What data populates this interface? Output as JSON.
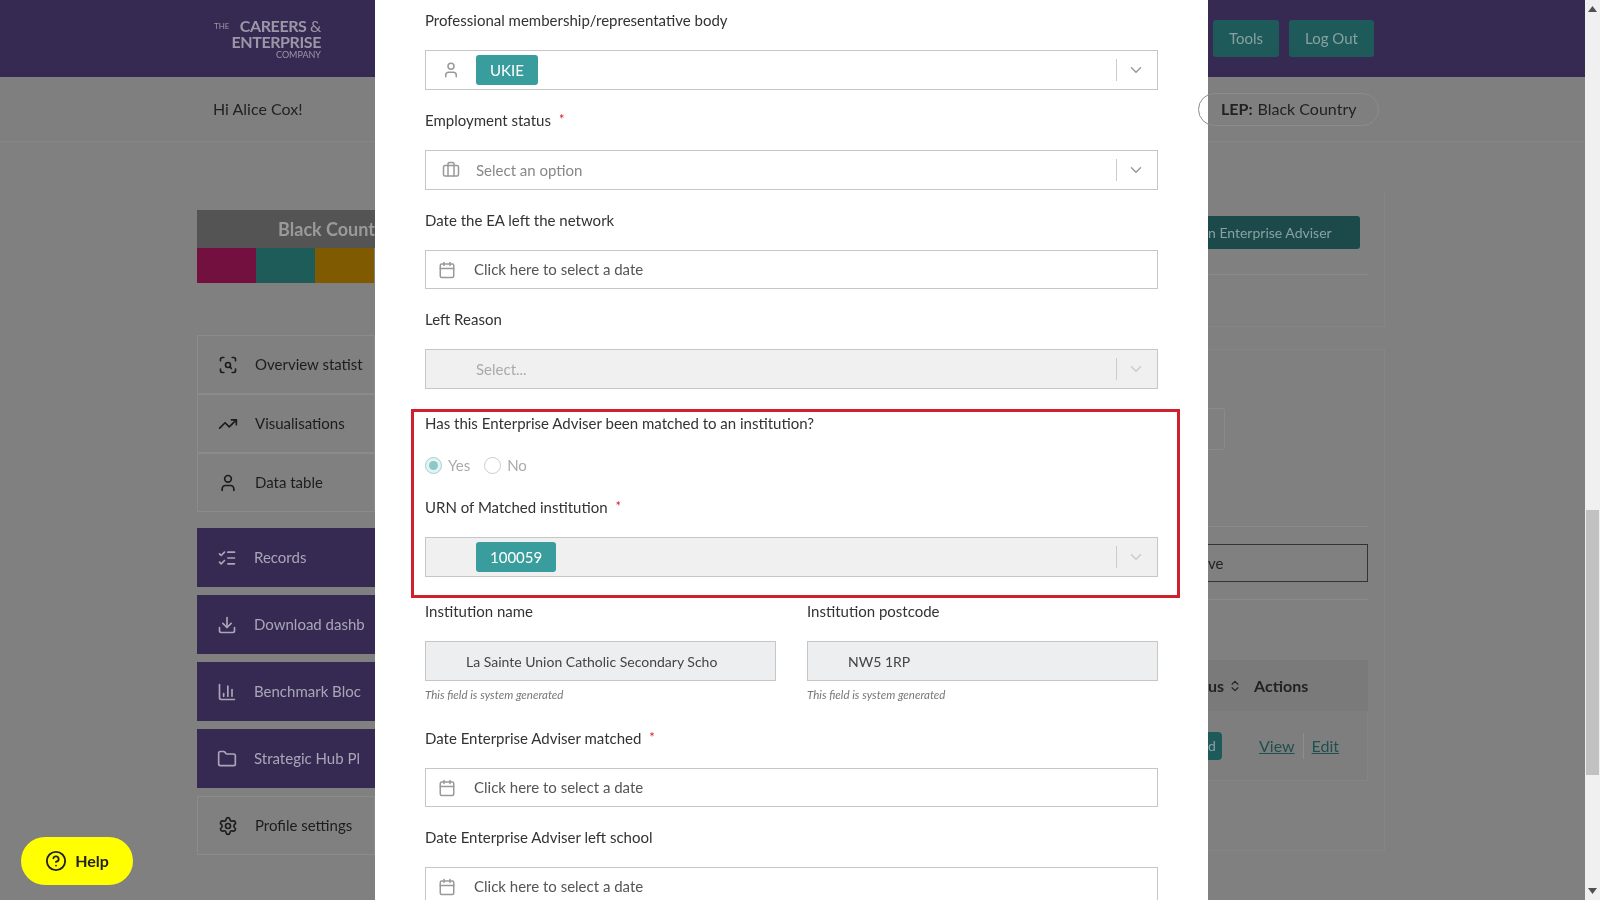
{
  "header": {
    "logo": {
      "the": "THE",
      "line1": "CAREERS",
      "amp": "&",
      "line2": "ENTERPRISE",
      "line3": "COMPANY"
    },
    "buttons": [
      "Tools",
      "Log Out"
    ]
  },
  "greeting": "Hi Alice Cox!",
  "lep": {
    "label": "LEP:",
    "value": "Black Country"
  },
  "banner": {
    "title": "Black Count"
  },
  "sidebar": {
    "items": [
      {
        "label": "Overview statist",
        "kind": "light"
      },
      {
        "label": "Visualisations",
        "kind": "light"
      },
      {
        "label": "Data table",
        "kind": "light"
      },
      {
        "label": "Records",
        "kind": "dark"
      },
      {
        "label": "Download dashb",
        "kind": "dark"
      },
      {
        "label": "Benchmark Bloc",
        "kind": "dark"
      },
      {
        "label": "Strategic Hub Pl",
        "kind": "dark"
      },
      {
        "label": "Profile settings",
        "kind": "light"
      }
    ]
  },
  "background": {
    "add_button": "n Enterprise Adviser",
    "search_value": "ve",
    "table": {
      "columns": [
        "us",
        "Actions"
      ],
      "status_badge": "d",
      "actions": [
        "View",
        "Edit"
      ]
    }
  },
  "help_button": "Help",
  "modal": {
    "fields": [
      {
        "kind": "select",
        "label": "Professional membership/representative body",
        "tag": "UKIE",
        "disabled": false
      },
      {
        "kind": "select",
        "label": "Employment status",
        "required_mark": "*",
        "placeholder": "Select an option",
        "disabled": false
      },
      {
        "kind": "date",
        "label": "Date the EA left the network",
        "placeholder": "Click here to select a date"
      },
      {
        "kind": "select",
        "label": "Left Reason",
        "placeholder": "Select...",
        "disabled": true
      },
      {
        "kind": "group",
        "highlighted": true,
        "children": [
          {
            "kind": "radio",
            "label": "Has this Enterprise Adviser been matched to an institution?",
            "disabled": true,
            "options": [
              {
                "label": "Yes",
                "selected": true
              },
              {
                "label": "No",
                "selected": false
              }
            ]
          },
          {
            "kind": "select",
            "label": "URN of Matched institution",
            "required_mark": "*",
            "tag": "100059",
            "disabled": true
          }
        ]
      },
      {
        "kind": "pair",
        "children": [
          {
            "kind": "text",
            "label": "Institution name",
            "value": "La Sainte Union Catholic Secondary Scho",
            "hint": "This field is system generated",
            "disabled": true
          },
          {
            "kind": "text",
            "label": "Institution postcode",
            "value": "NW5 1RP",
            "hint": "This field is system generated",
            "disabled": true
          }
        ]
      },
      {
        "kind": "date",
        "label": "Date Enterprise Adviser matched",
        "required_mark": "*",
        "placeholder": "Click here to select a date"
      },
      {
        "kind": "date",
        "label": "Date Enterprise Adviser left school",
        "placeholder": "Click here to select a date"
      }
    ]
  }
}
